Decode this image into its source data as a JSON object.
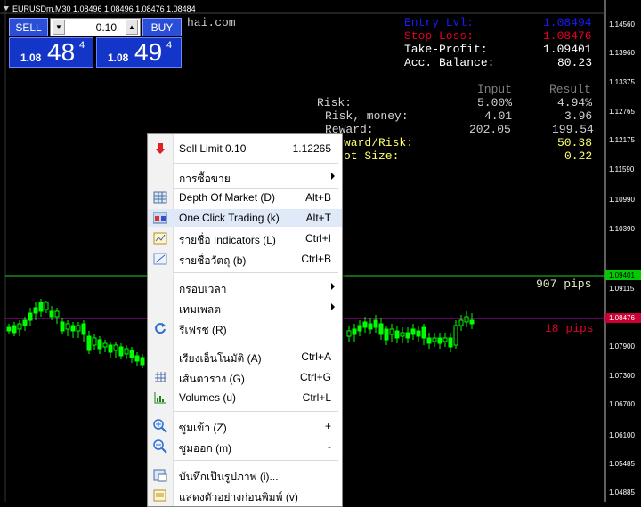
{
  "window": {
    "title": "EURUSDm,M30  1.08496 1.08496 1.08476 1.08484"
  },
  "trading_panel": {
    "sell_label": "SELL",
    "buy_label": "BUY",
    "lot_value": "0.10",
    "sell_price_small": "1.08",
    "sell_price_big": "48",
    "sell_price_sup": "4",
    "buy_price_small": "1.08",
    "buy_price_big": "49",
    "buy_price_sup": "4"
  },
  "watermark": "hai.com",
  "info_panel": {
    "entry_label": "Entry Lvl:",
    "entry_value": "1.08494",
    "stop_label": "Stop-Loss:",
    "stop_value": "1.08476",
    "tp_label": "Take-Profit:",
    "tp_value": "1.09401",
    "balance_label": "Acc. Balance:",
    "balance_value": "80.23",
    "col_input": "Input",
    "col_result": "Result",
    "risk_label": "Risk:",
    "risk_input": "5.00%",
    "risk_result": "4.94%",
    "risk_money_label": "Risk, money:",
    "risk_money_input": "4.01",
    "risk_money_result": "3.96",
    "reward_label": "Reward:",
    "reward_input": "202.05",
    "reward_result": "199.54",
    "rr_label": "Reward/Risk:",
    "rr_label_visible": "ward/Risk:",
    "rr_value": "50.38",
    "lot_label_visible": "ot Size:",
    "lot_value": "0.22"
  },
  "pips": {
    "tp_pips": "907 pips",
    "sl_pips": "18 pips"
  },
  "price_axis": {
    "labels": [
      "1.14560",
      "1.13960",
      "1.13375",
      "1.12765",
      "1.12175",
      "1.11590",
      "1.10990",
      "1.10390",
      "1.09115",
      "1.08515",
      "1.07900",
      "1.07300",
      "1.06700",
      "1.06100",
      "1.05485",
      "1.04885"
    ],
    "tp_tag": "1.09401",
    "sl_tag": "1.08476",
    "tp_tag_color": "#00cc00",
    "sl_tag_color": "#cc0033"
  },
  "context_menu": {
    "sell_limit": {
      "label": "Sell Limit 0.10",
      "shortcut": "1.12265"
    },
    "trading": {
      "label": "การซื้อขาย"
    },
    "depth": {
      "label": "Depth Of Market (D)",
      "shortcut": "Alt+B"
    },
    "one_click": {
      "label": "One Click Trading (k)",
      "shortcut": "Alt+T"
    },
    "indicators": {
      "label": "รายชื่อ Indicators (L)",
      "shortcut": "Ctrl+I"
    },
    "objects": {
      "label": "รายชื่อวัตถุ (b)",
      "shortcut": "Ctrl+B"
    },
    "timeframe": {
      "label": "กรอบเวลา"
    },
    "template": {
      "label": "เทมเพลต"
    },
    "refresh": {
      "label": "รีเฟรช (R)"
    },
    "autoscroll": {
      "label": "เรียงเอ็นโนมัติ (A)",
      "shortcut": "Ctrl+A"
    },
    "grid": {
      "label": "เส้นตาราง (G)",
      "shortcut": "Ctrl+G"
    },
    "volumes": {
      "label": "Volumes (u)",
      "shortcut": "Ctrl+L"
    },
    "zoom_in": {
      "label": "ซูมเข้า (Z)",
      "shortcut": "+"
    },
    "zoom_out": {
      "label": "ซูมออก (m)",
      "shortcut": "-"
    },
    "save_picture": {
      "label": "บันทึกเป็นรูปภาพ (i)..."
    },
    "print_preview": {
      "label": "แสดงตัวอย่างก่อนพิมพ์ (v)"
    }
  },
  "colors": {
    "entry": "#1a1aff",
    "stop": "#e0002a",
    "tp": "#ffffff",
    "info_grey": "#c0c0c0",
    "info_yellow": "#ffff66",
    "pips_tp": "#e8e8c8",
    "pips_sl": "#e0002a",
    "candle": "#00ff00"
  }
}
